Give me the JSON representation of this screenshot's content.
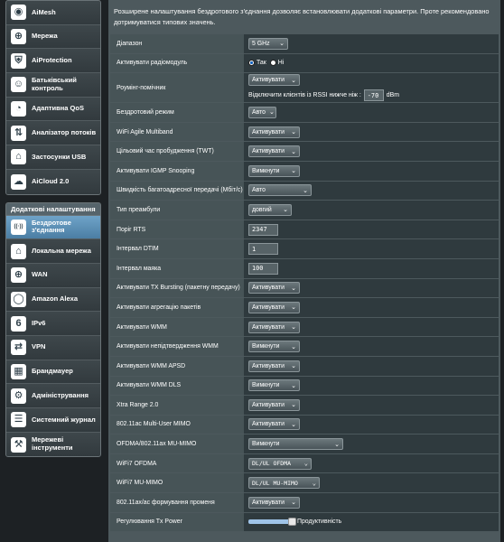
{
  "sidebar": {
    "top_items": [
      {
        "label": "AiMesh",
        "icon": "mesh-icon",
        "glyph": "◉"
      },
      {
        "label": "Мережа",
        "icon": "globe-icon",
        "glyph": "⊕"
      },
      {
        "label": "AiProtection",
        "icon": "shield-icon",
        "glyph": "⛨"
      },
      {
        "label": "Батьківський контроль",
        "icon": "family-icon",
        "glyph": "☺"
      },
      {
        "label": "Адаптивна QoS",
        "icon": "speedometer-icon",
        "glyph": "◔"
      },
      {
        "label": "Аналізатор потоків",
        "icon": "traffic-icon",
        "glyph": "⇅"
      },
      {
        "label": "Застосунки USB",
        "icon": "usb-icon",
        "glyph": "⌂"
      },
      {
        "label": "AiCloud 2.0",
        "icon": "cloud-icon",
        "glyph": "☁"
      }
    ],
    "advanced_header": "Додаткові налаштування",
    "advanced_items": [
      {
        "label": "Бездротове з'єднання",
        "icon": "wireless-icon",
        "glyph": "((·))",
        "active": true
      },
      {
        "label": "Локальна мережа",
        "icon": "home-network-icon",
        "glyph": "⌂"
      },
      {
        "label": "WAN",
        "icon": "wan-globe-icon",
        "glyph": "⊕"
      },
      {
        "label": "Amazon Alexa",
        "icon": "alexa-icon",
        "glyph": "◯"
      },
      {
        "label": "IPv6",
        "icon": "ipv6-icon",
        "glyph": "6"
      },
      {
        "label": "VPN",
        "icon": "vpn-icon",
        "glyph": "⇄"
      },
      {
        "label": "Брандмауер",
        "icon": "firewall-icon",
        "glyph": "▦"
      },
      {
        "label": "Адміністрування",
        "icon": "admin-icon",
        "glyph": "⚙"
      },
      {
        "label": "Системний журнал",
        "icon": "log-icon",
        "glyph": "☰"
      },
      {
        "label": "Мережеві інструменти",
        "icon": "tools-icon",
        "glyph": "⚒"
      }
    ]
  },
  "description": "Розширене налаштування бездротового з'єднання дозволяє встановлювати додаткові параметри. Проте рекомендовано дотримуватися типових значень.",
  "rows": {
    "band": {
      "label": "Діапазон",
      "value": "5 GHz"
    },
    "radio": {
      "label": "Активувати радіомодуль",
      "yes": "Так",
      "no": "Ні"
    },
    "roaming": {
      "label": "Роумінг-помічник",
      "value": "Активувати",
      "rssi_label": "Відключити клієнтів із RSSI нижче ніж :",
      "rssi_value": "-70",
      "rssi_unit": "dBm"
    },
    "wireless_mode": {
      "label": "Бездротовий режим",
      "value": "Авто"
    },
    "agile": {
      "label": "WiFi Agile Multiband",
      "value": "Активувати"
    },
    "twt": {
      "label": "Цільовий час пробудження (TWT)",
      "value": "Активувати"
    },
    "igmp": {
      "label": "Активувати IGMP Snooping",
      "value": "Вимкнути"
    },
    "multicast": {
      "label": "Швидкість багатоадресної передачі (Мбіт/с)",
      "value": "Авто"
    },
    "preamble": {
      "label": "Тип преамбули",
      "value": "довгий"
    },
    "rts": {
      "label": "Поріг RTS",
      "value": "2347"
    },
    "dtim": {
      "label": "Інтервал DTIM",
      "value": "1"
    },
    "beacon": {
      "label": "Інтервал маяка",
      "value": "100"
    },
    "tx_burst": {
      "label": "Активувати TX Bursting (пакетну передачу)",
      "value": "Активувати"
    },
    "aggregation": {
      "label": "Активувати агрегацію пакетів",
      "value": "Активувати"
    },
    "wmm": {
      "label": "Активувати WMM",
      "value": "Активувати"
    },
    "wmm_noack": {
      "label": "Активувати непідтвердження WMM",
      "value": "Вимкнути"
    },
    "wmm_apsd": {
      "label": "Активувати WMM APSD",
      "value": "Активувати"
    },
    "wmm_dls": {
      "label": "Активувати WMM DLS",
      "value": "Вимкнути"
    },
    "xtra": {
      "label": "Xtra Range 2.0",
      "value": "Активувати"
    },
    "mumimo": {
      "label": "802.11ac Multi-User MIMO",
      "value": "Активувати"
    },
    "ofdma": {
      "label": "OFDMA/802.11ax MU-MIMO",
      "value": "Вимкнути"
    },
    "wifi7_ofdma": {
      "label": "WiFi7 OFDMA",
      "value": "DL/UL OFDMA"
    },
    "wifi7_mumimo": {
      "label": "WiFi7 MU-MIMO",
      "value": "DL/UL MU-MIMO"
    },
    "beamforming": {
      "label": "802.11ax/ac формування променя",
      "value": "Активувати"
    },
    "txpower": {
      "label": "Регулювання Tx Power",
      "value": "Продуктивність",
      "level_percent": 100
    }
  }
}
